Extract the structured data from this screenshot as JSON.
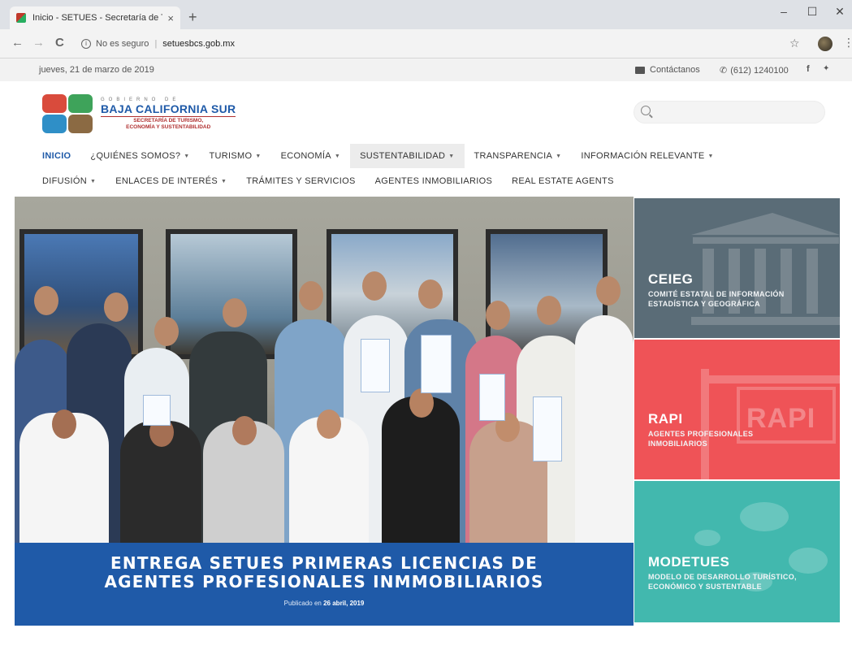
{
  "browser": {
    "tab_title": "Inicio - SETUES - Secretaría de T...",
    "tab_close": "×",
    "new_tab": "+",
    "win_min": "–",
    "win_max": "☐",
    "win_close": "✕",
    "nav_back": "←",
    "nav_forward": "→",
    "nav_reload": "C",
    "security_text": "No es seguro",
    "url": "setuesbcs.gob.mx",
    "star": "☆",
    "menu": "⋮"
  },
  "topbar": {
    "date": "jueves, 21 de marzo de 2019",
    "contact_label": "Contáctanos",
    "phone": "(612) 1240100",
    "facebook": "f",
    "twitter": "🐦"
  },
  "logo": {
    "gobierno": "GOBIERNO DE",
    "name": "BAJA CALIFORNIA SUR",
    "sub_line1": "SECRETARÍA DE TURISMO,",
    "sub_line2": "ECONOMÍA Y SUSTENTABILIDAD"
  },
  "search": {
    "placeholder": ""
  },
  "menu_row1": [
    {
      "label": "INICIO",
      "caret": false,
      "active": true
    },
    {
      "label": "¿QUIÉNES SOMOS?",
      "caret": true
    },
    {
      "label": "TURISMO",
      "caret": true
    },
    {
      "label": "ECONOMÍA",
      "caret": true
    },
    {
      "label": "SUSTENTABILIDAD",
      "caret": true,
      "highlight": true
    },
    {
      "label": "TRANSPARENCIA",
      "caret": true
    },
    {
      "label": "INFORMACIÓN RELEVANTE",
      "caret": true
    }
  ],
  "menu_row2": [
    {
      "label": "DIFUSIÓN",
      "caret": true
    },
    {
      "label": "ENLACES DE INTERÉS",
      "caret": true
    },
    {
      "label": "TRÁMITES Y SERVICIOS",
      "caret": false
    },
    {
      "label": "AGENTES INMOBILIARIOS",
      "caret": false
    },
    {
      "label": "REAL ESTATE AGENTS",
      "caret": false
    }
  ],
  "hero": {
    "title_line1": "ENTREGA SETUES PRIMERAS LICENCIAS DE",
    "title_line2": "AGENTES PROFESIONALES INMMOBILIARIOS",
    "published_prefix": "Publicado en",
    "published_date": "26 abril, 2019"
  },
  "cards": {
    "ceieg": {
      "title": "CEIEG",
      "desc": "COMITÉ ESTATAL DE INFORMACIÓN ESTADÍSTICA Y GEOGRÁFICA",
      "color": "#5a6c77"
    },
    "rapi": {
      "title": "RAPI",
      "desc": "AGENTES PROFESIONALES INMOBILIARIOS",
      "sign": "RAPI",
      "color": "#ef5357"
    },
    "modetues": {
      "title": "MODETUES",
      "desc": "MODELO DE DESARROLLO TURÍSTICO, ECONÓMICO Y SUSTENTABLE",
      "color": "#42b8ae"
    }
  },
  "colors": {
    "brand_blue": "#1f5aa8",
    "brand_red": "#b03030"
  }
}
